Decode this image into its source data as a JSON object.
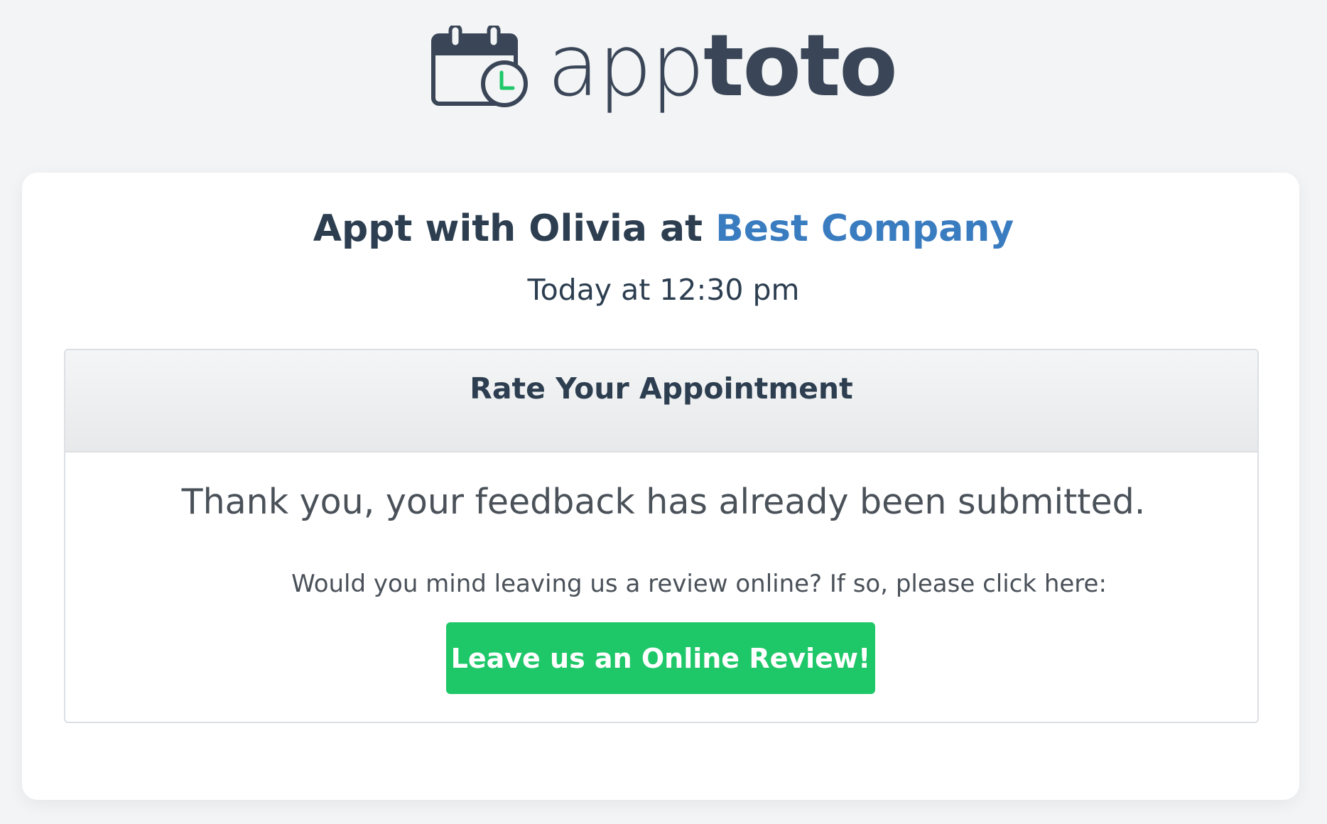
{
  "brand": {
    "logo_text_light": "app",
    "logo_text_bold": "toto",
    "logo_icon": "calendar-clock-icon",
    "clock_accent_color": "#1ec768",
    "text_color": "#3a4657"
  },
  "appointment": {
    "title_prefix": "Appt with Olivia at",
    "company": "Best Company",
    "company_color": "#3a7cc0",
    "time": "Today at 12:30 pm"
  },
  "rating_panel": {
    "header": "Rate Your Appointment",
    "thank_you": "Thank you, your feedback has already been submitted.",
    "review_prompt": "Would you mind leaving us a review online? If so, please click here:",
    "review_button_label": "Leave us an Online Review!",
    "review_button_color": "#1ec768"
  }
}
